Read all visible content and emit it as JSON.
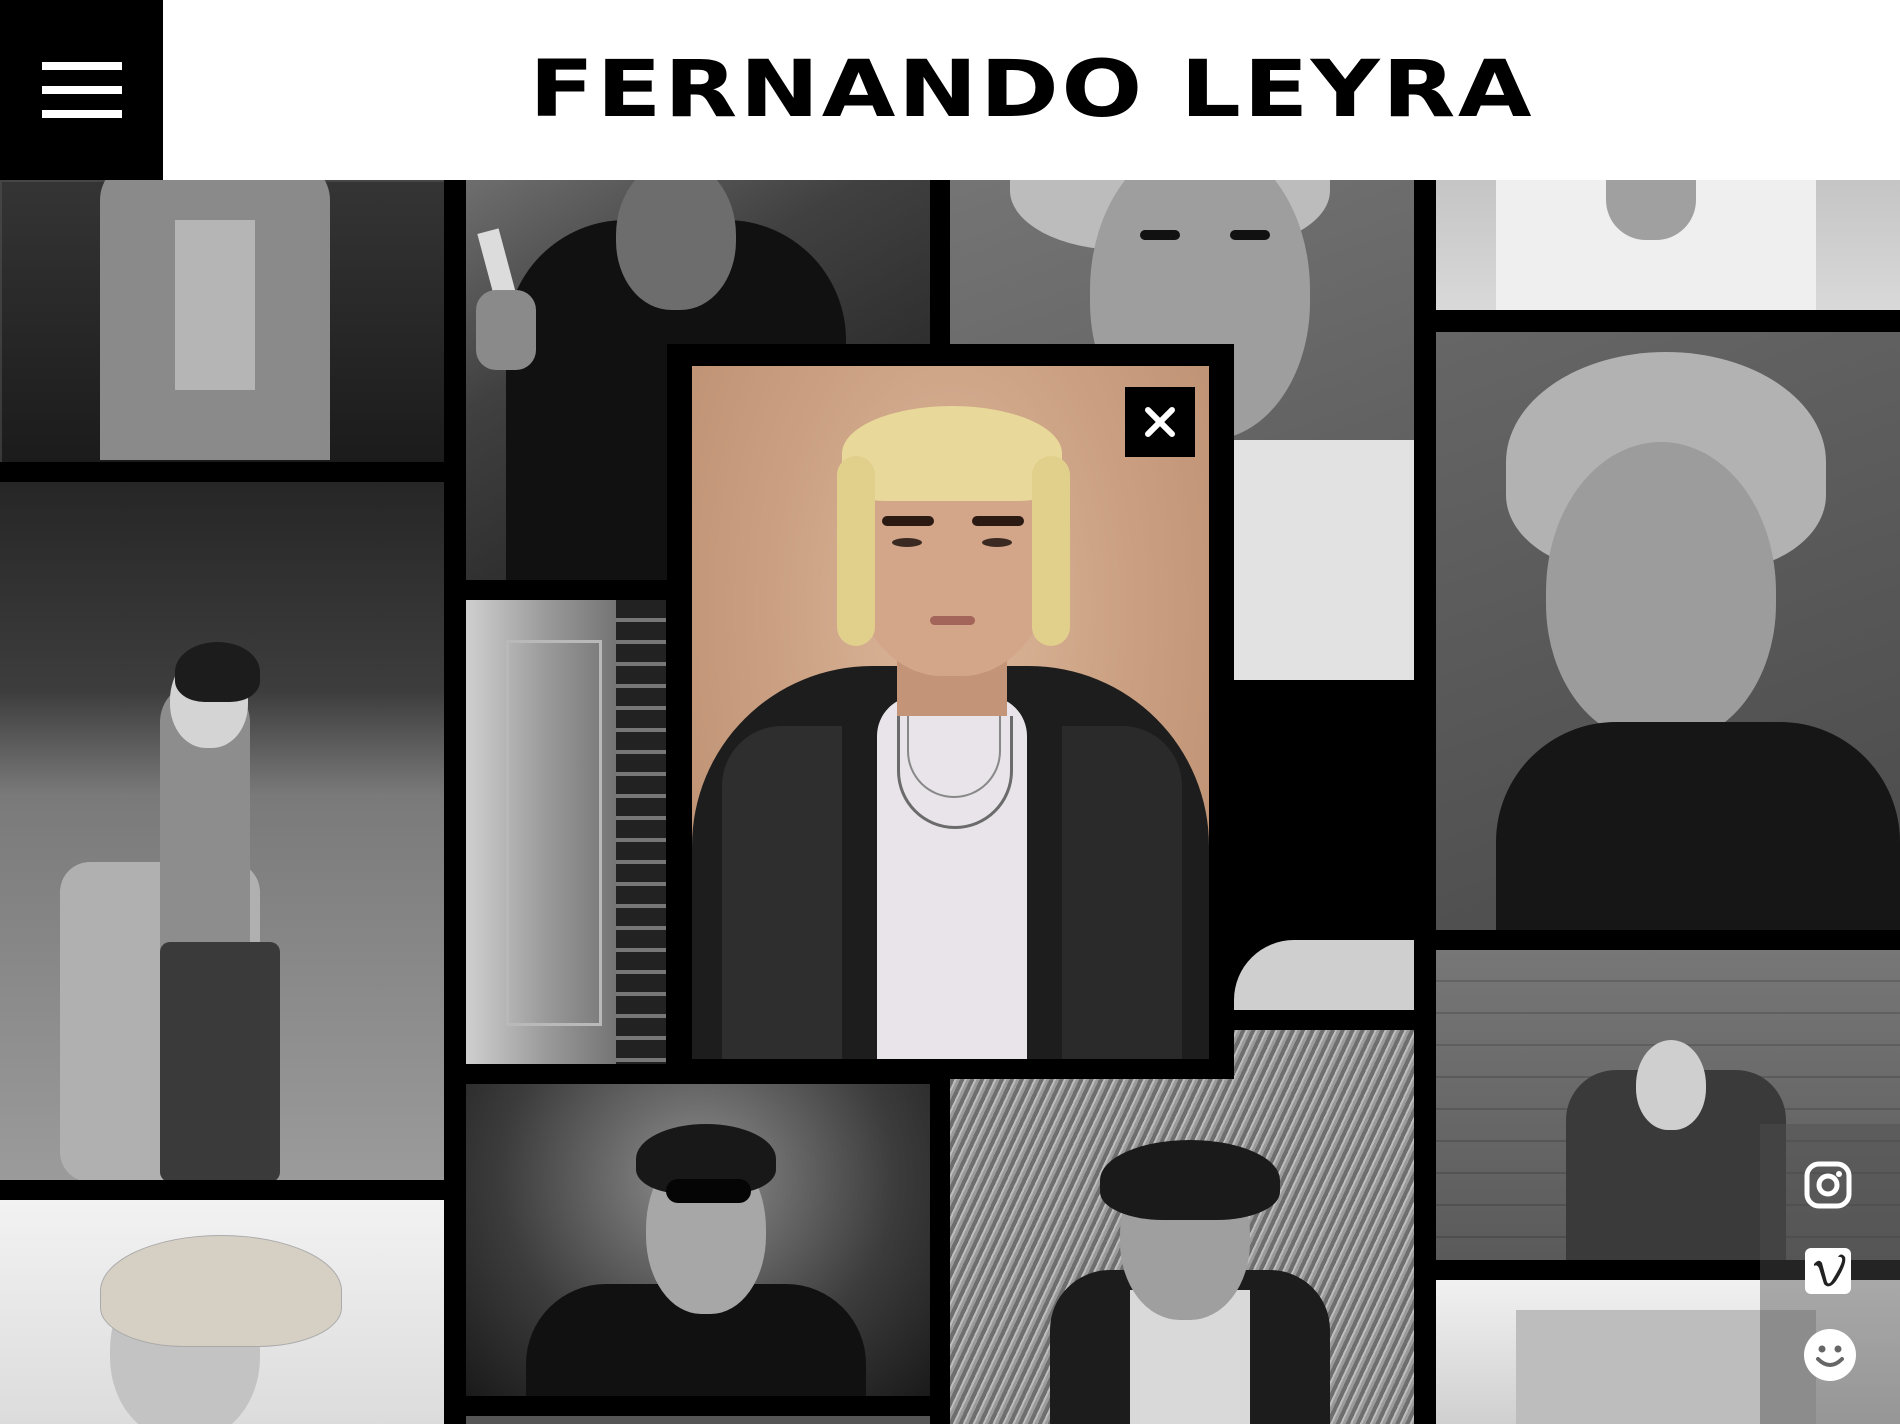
{
  "site": {
    "title": "FERNANDO LEYRA"
  },
  "menu": {
    "icon": "hamburger-menu-icon"
  },
  "gallery": {
    "photos": [
      "photo-1",
      "photo-2",
      "photo-3",
      "photo-4",
      "photo-5",
      "photo-6",
      "photo-7",
      "photo-8",
      "photo-9",
      "photo-10",
      "photo-11",
      "photo-12",
      "photo-13",
      "photo-14",
      "photo-15",
      "photo-16"
    ]
  },
  "modal": {
    "close_icon": "close-icon"
  },
  "social": {
    "icons": [
      "instagram-icon",
      "vimeo-icon",
      "smiley-face-icon"
    ]
  },
  "colors": {
    "background": "#000000",
    "header": "#ffffff",
    "accent_photo": "#c99d7f"
  }
}
